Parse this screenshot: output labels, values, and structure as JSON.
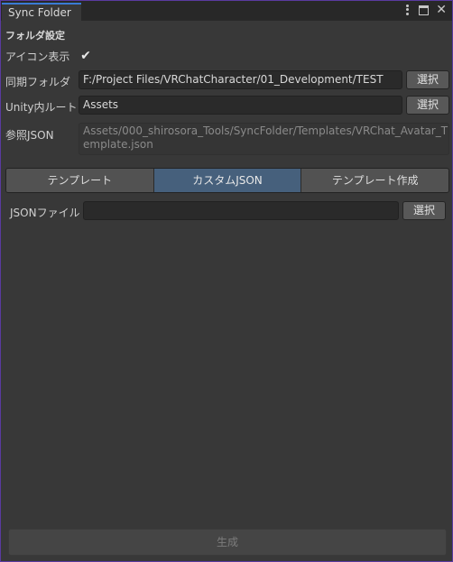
{
  "window": {
    "tab_title": "Sync Folder"
  },
  "folder_settings": {
    "section_title": "フォルダ設定",
    "icon_display_label": "アイコン表示",
    "icon_display_checked": true,
    "sync_folder_label": "同期フォルダ",
    "sync_folder_value": "F:/Project Files/VRChatCharacter/01_Development/TEST",
    "sync_folder_button": "選択",
    "unity_root_label": "Unity内ルート",
    "unity_root_value": "Assets",
    "unity_root_button": "選択",
    "ref_json_label": "参照JSON",
    "ref_json_value": "Assets/000_shirosora_Tools/SyncFolder/Templates/VRChat_Avatar_Template.json"
  },
  "tabs": [
    {
      "label": "テンプレート",
      "active": false
    },
    {
      "label": "カスタムJSON",
      "active": true
    },
    {
      "label": "テンプレート作成",
      "active": false
    }
  ],
  "custom_json": {
    "json_file_label": "JSONファイル",
    "json_file_value": "",
    "json_file_button": "選択"
  },
  "footer": {
    "generate_button": "生成"
  }
}
